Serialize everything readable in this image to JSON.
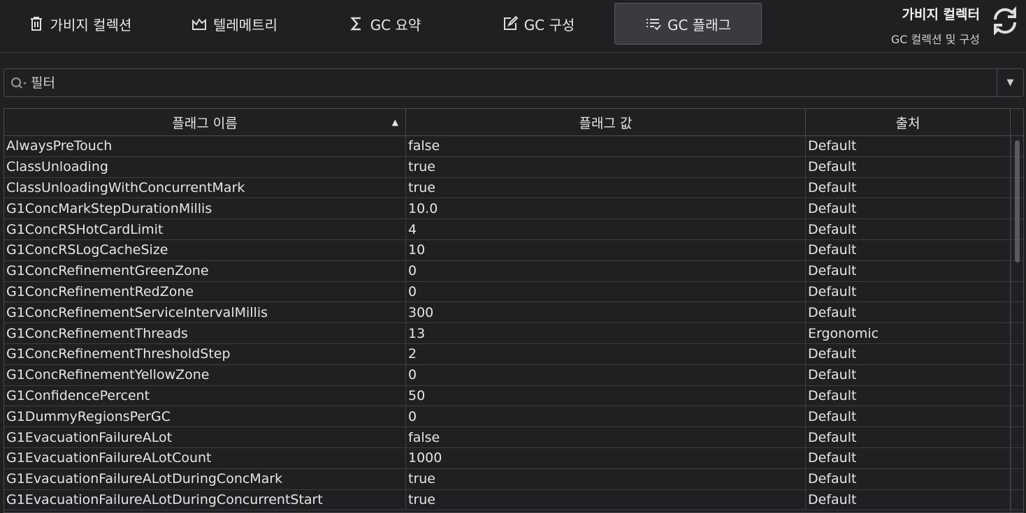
{
  "tabs": [
    {
      "label": "가비지 컬렉션",
      "icon": "trash-icon"
    },
    {
      "label": "텔레메트리",
      "icon": "chart-area-icon"
    },
    {
      "label": "GC 요약",
      "icon": "sigma-icon"
    },
    {
      "label": "GC 구성",
      "icon": "edit-icon"
    },
    {
      "label": "GC 플래그",
      "icon": "list-check-icon",
      "active": true
    }
  ],
  "header": {
    "title": "가비지 컬렉터",
    "subtitle": "GC 컬렉션 및 구성"
  },
  "filter": {
    "placeholder": "필터"
  },
  "table": {
    "columns": [
      "플래그 이름",
      "플래그 값",
      "출처"
    ],
    "rows": [
      [
        "AlwaysPreTouch",
        "false",
        "Default"
      ],
      [
        "ClassUnloading",
        "true",
        "Default"
      ],
      [
        "ClassUnloadingWithConcurrentMark",
        "true",
        "Default"
      ],
      [
        "G1ConcMarkStepDurationMillis",
        "10.0",
        "Default"
      ],
      [
        "G1ConcRSHotCardLimit",
        "4",
        "Default"
      ],
      [
        "G1ConcRSLogCacheSize",
        "10",
        "Default"
      ],
      [
        "G1ConcRefinementGreenZone",
        "0",
        "Default"
      ],
      [
        "G1ConcRefinementRedZone",
        "0",
        "Default"
      ],
      [
        "G1ConcRefinementServiceIntervalMillis",
        "300",
        "Default"
      ],
      [
        "G1ConcRefinementThreads",
        "13",
        "Ergonomic"
      ],
      [
        "G1ConcRefinementThresholdStep",
        "2",
        "Default"
      ],
      [
        "G1ConcRefinementYellowZone",
        "0",
        "Default"
      ],
      [
        "G1ConfidencePercent",
        "50",
        "Default"
      ],
      [
        "G1DummyRegionsPerGC",
        "0",
        "Default"
      ],
      [
        "G1EvacuationFailureALot",
        "false",
        "Default"
      ],
      [
        "G1EvacuationFailureALotCount",
        "1000",
        "Default"
      ],
      [
        "G1EvacuationFailureALotDuringConcMark",
        "true",
        "Default"
      ],
      [
        "G1EvacuationFailureALotDuringConcurrentStart",
        "true",
        "Default"
      ]
    ]
  }
}
